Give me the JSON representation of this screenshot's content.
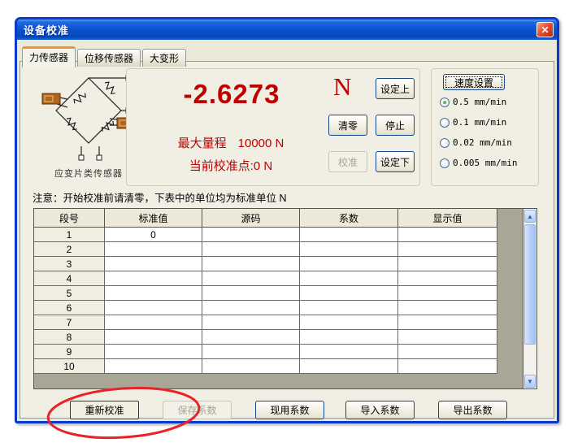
{
  "window": {
    "title": "设备校准"
  },
  "icons": {
    "close": "✕",
    "scroll_up": "▲",
    "scroll_down": "▼"
  },
  "tabs": [
    {
      "label": "力传感器",
      "active": true
    },
    {
      "label": "位移传感器",
      "active": false
    },
    {
      "label": "大变形",
      "active": false
    }
  ],
  "sensor": {
    "caption": "应变片类传感器"
  },
  "display": {
    "value": "-2.6273",
    "unit": "N",
    "max_range_label": "最大量程",
    "max_range_value": "10000 N",
    "cal_point_label": "当前校准点:",
    "cal_point_value": "0 N"
  },
  "control_buttons": {
    "set_upper": "设定上",
    "zero": "清零",
    "stop": "停止",
    "calibrate": "校准",
    "set_lower": "设定下"
  },
  "speed": {
    "title": "速度设置",
    "options": [
      {
        "label": "0.5 mm/min",
        "selected": true
      },
      {
        "label": "0.1 mm/min",
        "selected": false
      },
      {
        "label": "0.02 mm/min",
        "selected": false
      },
      {
        "label": "0.005 mm/min",
        "selected": false
      }
    ]
  },
  "note": "注意：开始校准前请清零，下表中的单位均为标准单位 N",
  "table": {
    "headers": [
      "段号",
      "标准值",
      "源码",
      "系数",
      "显示值"
    ],
    "rows": [
      {
        "seg": "1",
        "standard": "0",
        "source": "",
        "coef": "",
        "display": ""
      },
      {
        "seg": "2",
        "standard": "",
        "source": "",
        "coef": "",
        "display": ""
      },
      {
        "seg": "3",
        "standard": "",
        "source": "",
        "coef": "",
        "display": ""
      },
      {
        "seg": "4",
        "standard": "",
        "source": "",
        "coef": "",
        "display": ""
      },
      {
        "seg": "5",
        "standard": "",
        "source": "",
        "coef": "",
        "display": ""
      },
      {
        "seg": "6",
        "standard": "",
        "source": "",
        "coef": "",
        "display": ""
      },
      {
        "seg": "7",
        "standard": "",
        "source": "",
        "coef": "",
        "display": ""
      },
      {
        "seg": "8",
        "standard": "",
        "source": "",
        "coef": "",
        "display": ""
      },
      {
        "seg": "9",
        "standard": "",
        "source": "",
        "coef": "",
        "display": ""
      },
      {
        "seg": "10",
        "standard": "",
        "source": "",
        "coef": "",
        "display": ""
      }
    ]
  },
  "bottom_buttons": {
    "recalibrate": "重新校准",
    "save_coef": "保存系数",
    "current_coef": "现用系数",
    "import_coef": "导入系数",
    "export_coef": "导出系数"
  },
  "colors": {
    "titlebar_blue": "#0B54D2",
    "value_red": "#C00000",
    "annotation_red": "#EA2328",
    "radio_green": "#1E9A1E",
    "dialog_face": "#ECE9D8"
  }
}
